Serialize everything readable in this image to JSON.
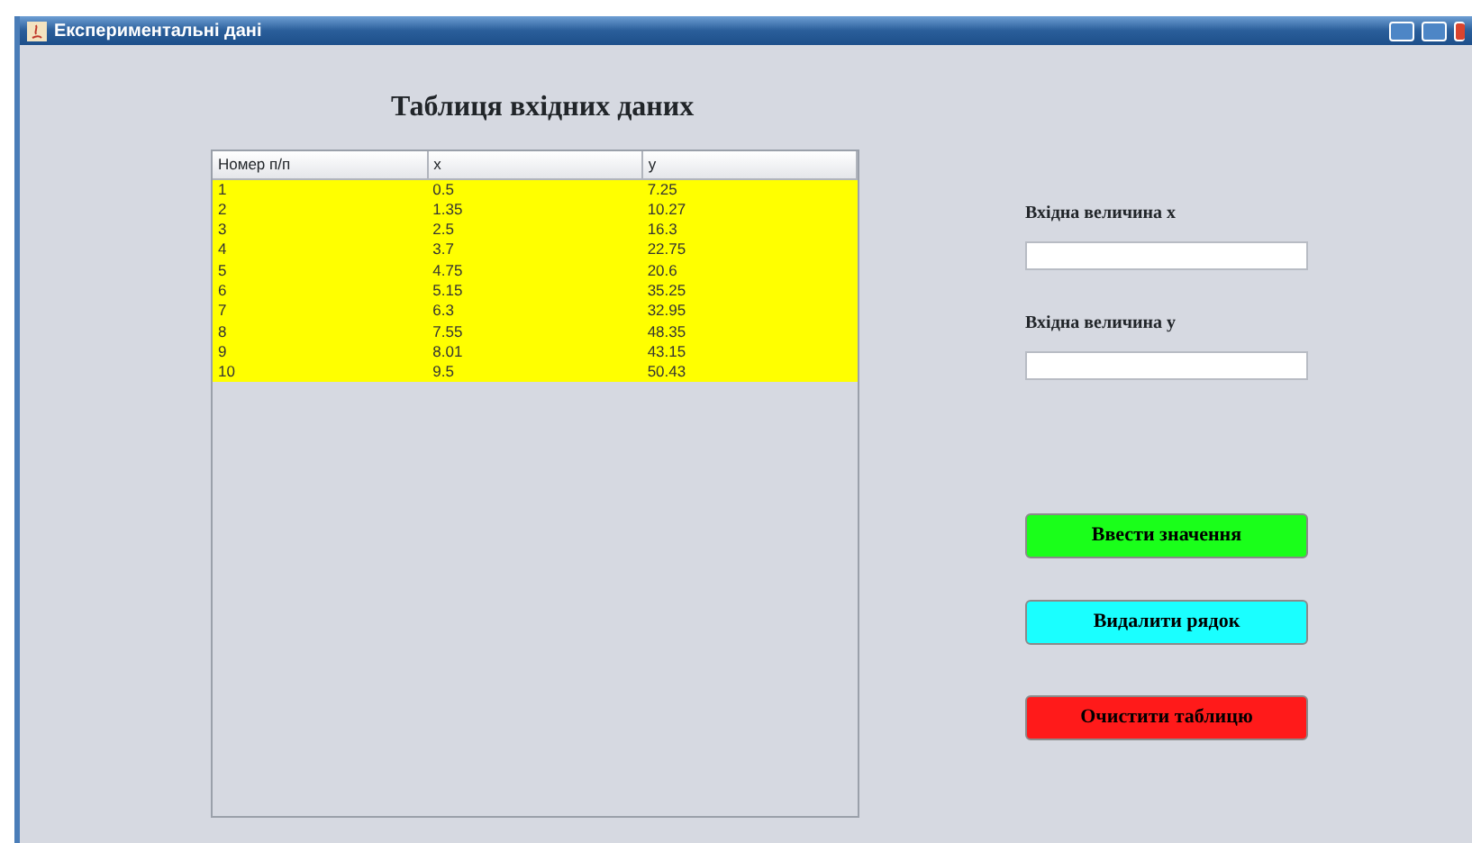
{
  "window": {
    "title": "Експериментальні дані"
  },
  "heading": "Таблиця вхідних даних",
  "table": {
    "columns": [
      "Номер п/п",
      "x",
      "y"
    ],
    "rows": [
      [
        "1",
        "0.5",
        "7.25"
      ],
      [
        "2",
        "1.35",
        "10.27"
      ],
      [
        "3",
        "2.5",
        "16.3"
      ],
      [
        "4",
        "3.7",
        "22.75"
      ],
      [
        "5",
        "4.75",
        "20.6"
      ],
      [
        "6",
        "5.15",
        "35.25"
      ],
      [
        "7",
        "6.3",
        "32.95"
      ],
      [
        "8",
        "7.55",
        "48.35"
      ],
      [
        "9",
        "8.01",
        "43.15"
      ],
      [
        "10",
        "9.5",
        "50.43"
      ]
    ]
  },
  "fields": [
    {
      "label": "Вхідна величина x"
    },
    {
      "label": "Вхідна величина y"
    }
  ],
  "buttons": [
    {
      "label": "Ввести значення",
      "color": "#1aff1a"
    },
    {
      "label": "Видалити рядок",
      "color": "#1affff"
    },
    {
      "label": "Очистити таблицю",
      "color": "#ff1a1a"
    }
  ]
}
